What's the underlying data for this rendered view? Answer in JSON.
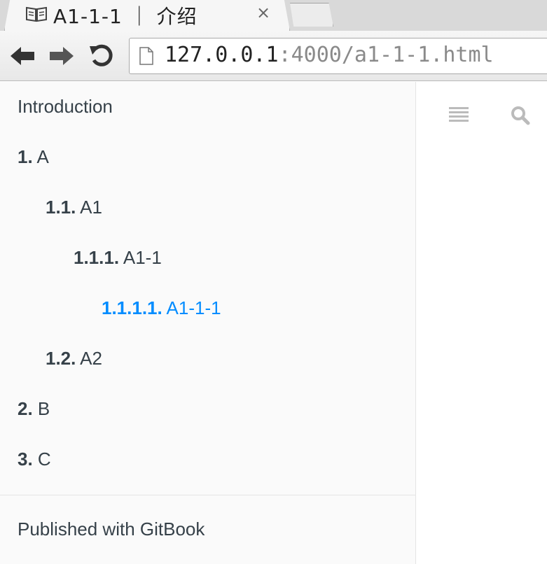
{
  "browser": {
    "tab_title": "A1-1-1 ｜ 介绍",
    "close_glyph": "×",
    "url_host": "127.0.0.1",
    "url_rest": ":4000/a1-1-1.html"
  },
  "sidebar": {
    "intro": "Introduction",
    "items": [
      {
        "num": "1.",
        "label": "A"
      },
      {
        "num": "1.1.",
        "label": "A1"
      },
      {
        "num": "1.1.1.",
        "label": "A1-1"
      },
      {
        "num": "1.1.1.1.",
        "label": "A1-1-1"
      },
      {
        "num": "1.2.",
        "label": "A2"
      },
      {
        "num": "2.",
        "label": "B"
      },
      {
        "num": "3.",
        "label": "C"
      }
    ],
    "footer": "Published with GitBook"
  },
  "toolbar_icons": [
    "list-icon",
    "search-icon"
  ],
  "colors": {
    "active_link": "#008cff",
    "text": "#364149",
    "sidebar_bg": "#fafafa"
  }
}
